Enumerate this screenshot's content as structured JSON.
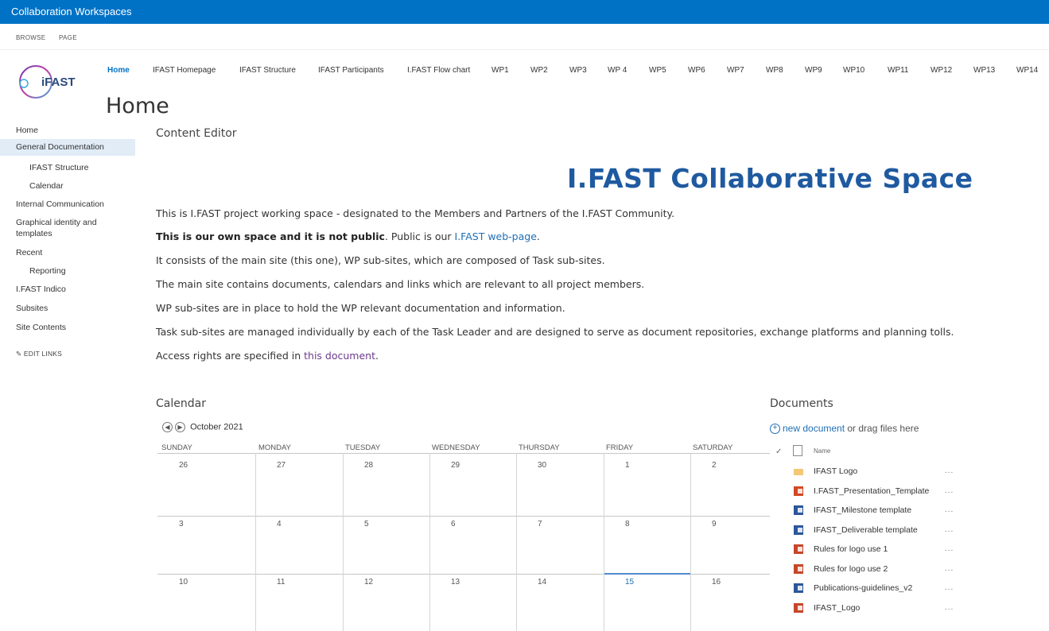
{
  "suite_bar": {
    "title": "Collaboration Workspaces"
  },
  "ribbon": {
    "browse": "BROWSE",
    "page": "PAGE"
  },
  "logo": {
    "text": "iFAST"
  },
  "top_nav": [
    {
      "label": "Home",
      "active": true
    },
    {
      "label": "IFAST Homepage"
    },
    {
      "label": "IFAST Structure"
    },
    {
      "label": "IFAST Participants"
    },
    {
      "label": "I.FAST Flow chart"
    },
    {
      "label": "WP1"
    },
    {
      "label": "WP2"
    },
    {
      "label": "WP3"
    },
    {
      "label": "WP 4"
    },
    {
      "label": "WP5"
    },
    {
      "label": "WP6"
    },
    {
      "label": "WP7"
    },
    {
      "label": "WP8"
    },
    {
      "label": "WP9"
    },
    {
      "label": "WP10"
    },
    {
      "label": "WP11"
    },
    {
      "label": "WP12"
    },
    {
      "label": "WP13"
    },
    {
      "label": "WP14"
    }
  ],
  "page_title": "Home",
  "left_nav": [
    {
      "label": "Home"
    },
    {
      "label": "General Documentation",
      "selected": true
    },
    {
      "label": "IFAST Structure",
      "sub": true
    },
    {
      "label": "Calendar",
      "sub": true
    },
    {
      "label": "Internal Communication"
    },
    {
      "label": "Graphical identity and"
    },
    {
      "label": "templates"
    },
    {
      "label": "Recent"
    },
    {
      "label": "Reporting",
      "sub": true
    },
    {
      "label": "I.FAST Indico"
    },
    {
      "label": "Subsites"
    },
    {
      "label": "Site Contents"
    }
  ],
  "edit_links": "EDIT LINKS",
  "content_editor": {
    "webpart_title": "Content Editor",
    "heading": "I.FAST Collaborative Space",
    "p1": "This is I.FAST project working space - designated to the Members and Partners of the I.FAST Community.",
    "p2_bold": "This is our own space and it is not public",
    "p2_rest": ". Public is our ",
    "p2_link": "I.FAST web-page",
    "p2_end": ".",
    "p3": "It consists of the main site (this one), WP sub-sites, which are composed of Task sub-sites.",
    "p4": "The main site contains documents, calendars and links which are relevant to all project members.",
    "p5": "WP sub-sites are in place to hold the WP relevant documentation and information.",
    "p6": "Task sub-sites are managed individually by each of the Task Leader and are designed to serve as document repositories, exchange platforms and planning tolls.",
    "p7_pre": "Access rights are specified in ",
    "p7_link": "this document",
    "p7_end": "."
  },
  "calendar": {
    "webpart_title": "Calendar",
    "month": "October 2021",
    "days": [
      "SUNDAY",
      "MONDAY",
      "TUESDAY",
      "WEDNESDAY",
      "THURSDAY",
      "FRIDAY",
      "SATURDAY"
    ],
    "weeks": [
      [
        "26",
        "27",
        "28",
        "29",
        "30",
        "1",
        "2"
      ],
      [
        "3",
        "4",
        "5",
        "6",
        "7",
        "8",
        "9"
      ],
      [
        "10",
        "11",
        "12",
        "13",
        "14",
        "15",
        "16"
      ]
    ],
    "today": "15"
  },
  "documents": {
    "webpart_title": "Documents",
    "new_link": "new document",
    "new_rest": " or drag files here",
    "col_name": "Name",
    "items": [
      {
        "name": "IFAST Logo",
        "type": "folder"
      },
      {
        "name": "I.FAST_Presentation_Template",
        "type": "ppt"
      },
      {
        "name": "IFAST_Milestone template",
        "type": "word"
      },
      {
        "name": "IFAST_Deliverable template",
        "type": "word"
      },
      {
        "name": "Rules for logo use 1",
        "type": "img"
      },
      {
        "name": "Rules for logo use 2",
        "type": "img"
      },
      {
        "name": "Publications-guidelines_v2",
        "type": "word"
      },
      {
        "name": "IFAST_Logo",
        "type": "img"
      }
    ],
    "more": "..."
  },
  "colors": {
    "suite_bar": "#0072c6",
    "heading": "#1f5aa0",
    "link": "#1f6fb5",
    "selected_nav": "#e1ecf7"
  }
}
